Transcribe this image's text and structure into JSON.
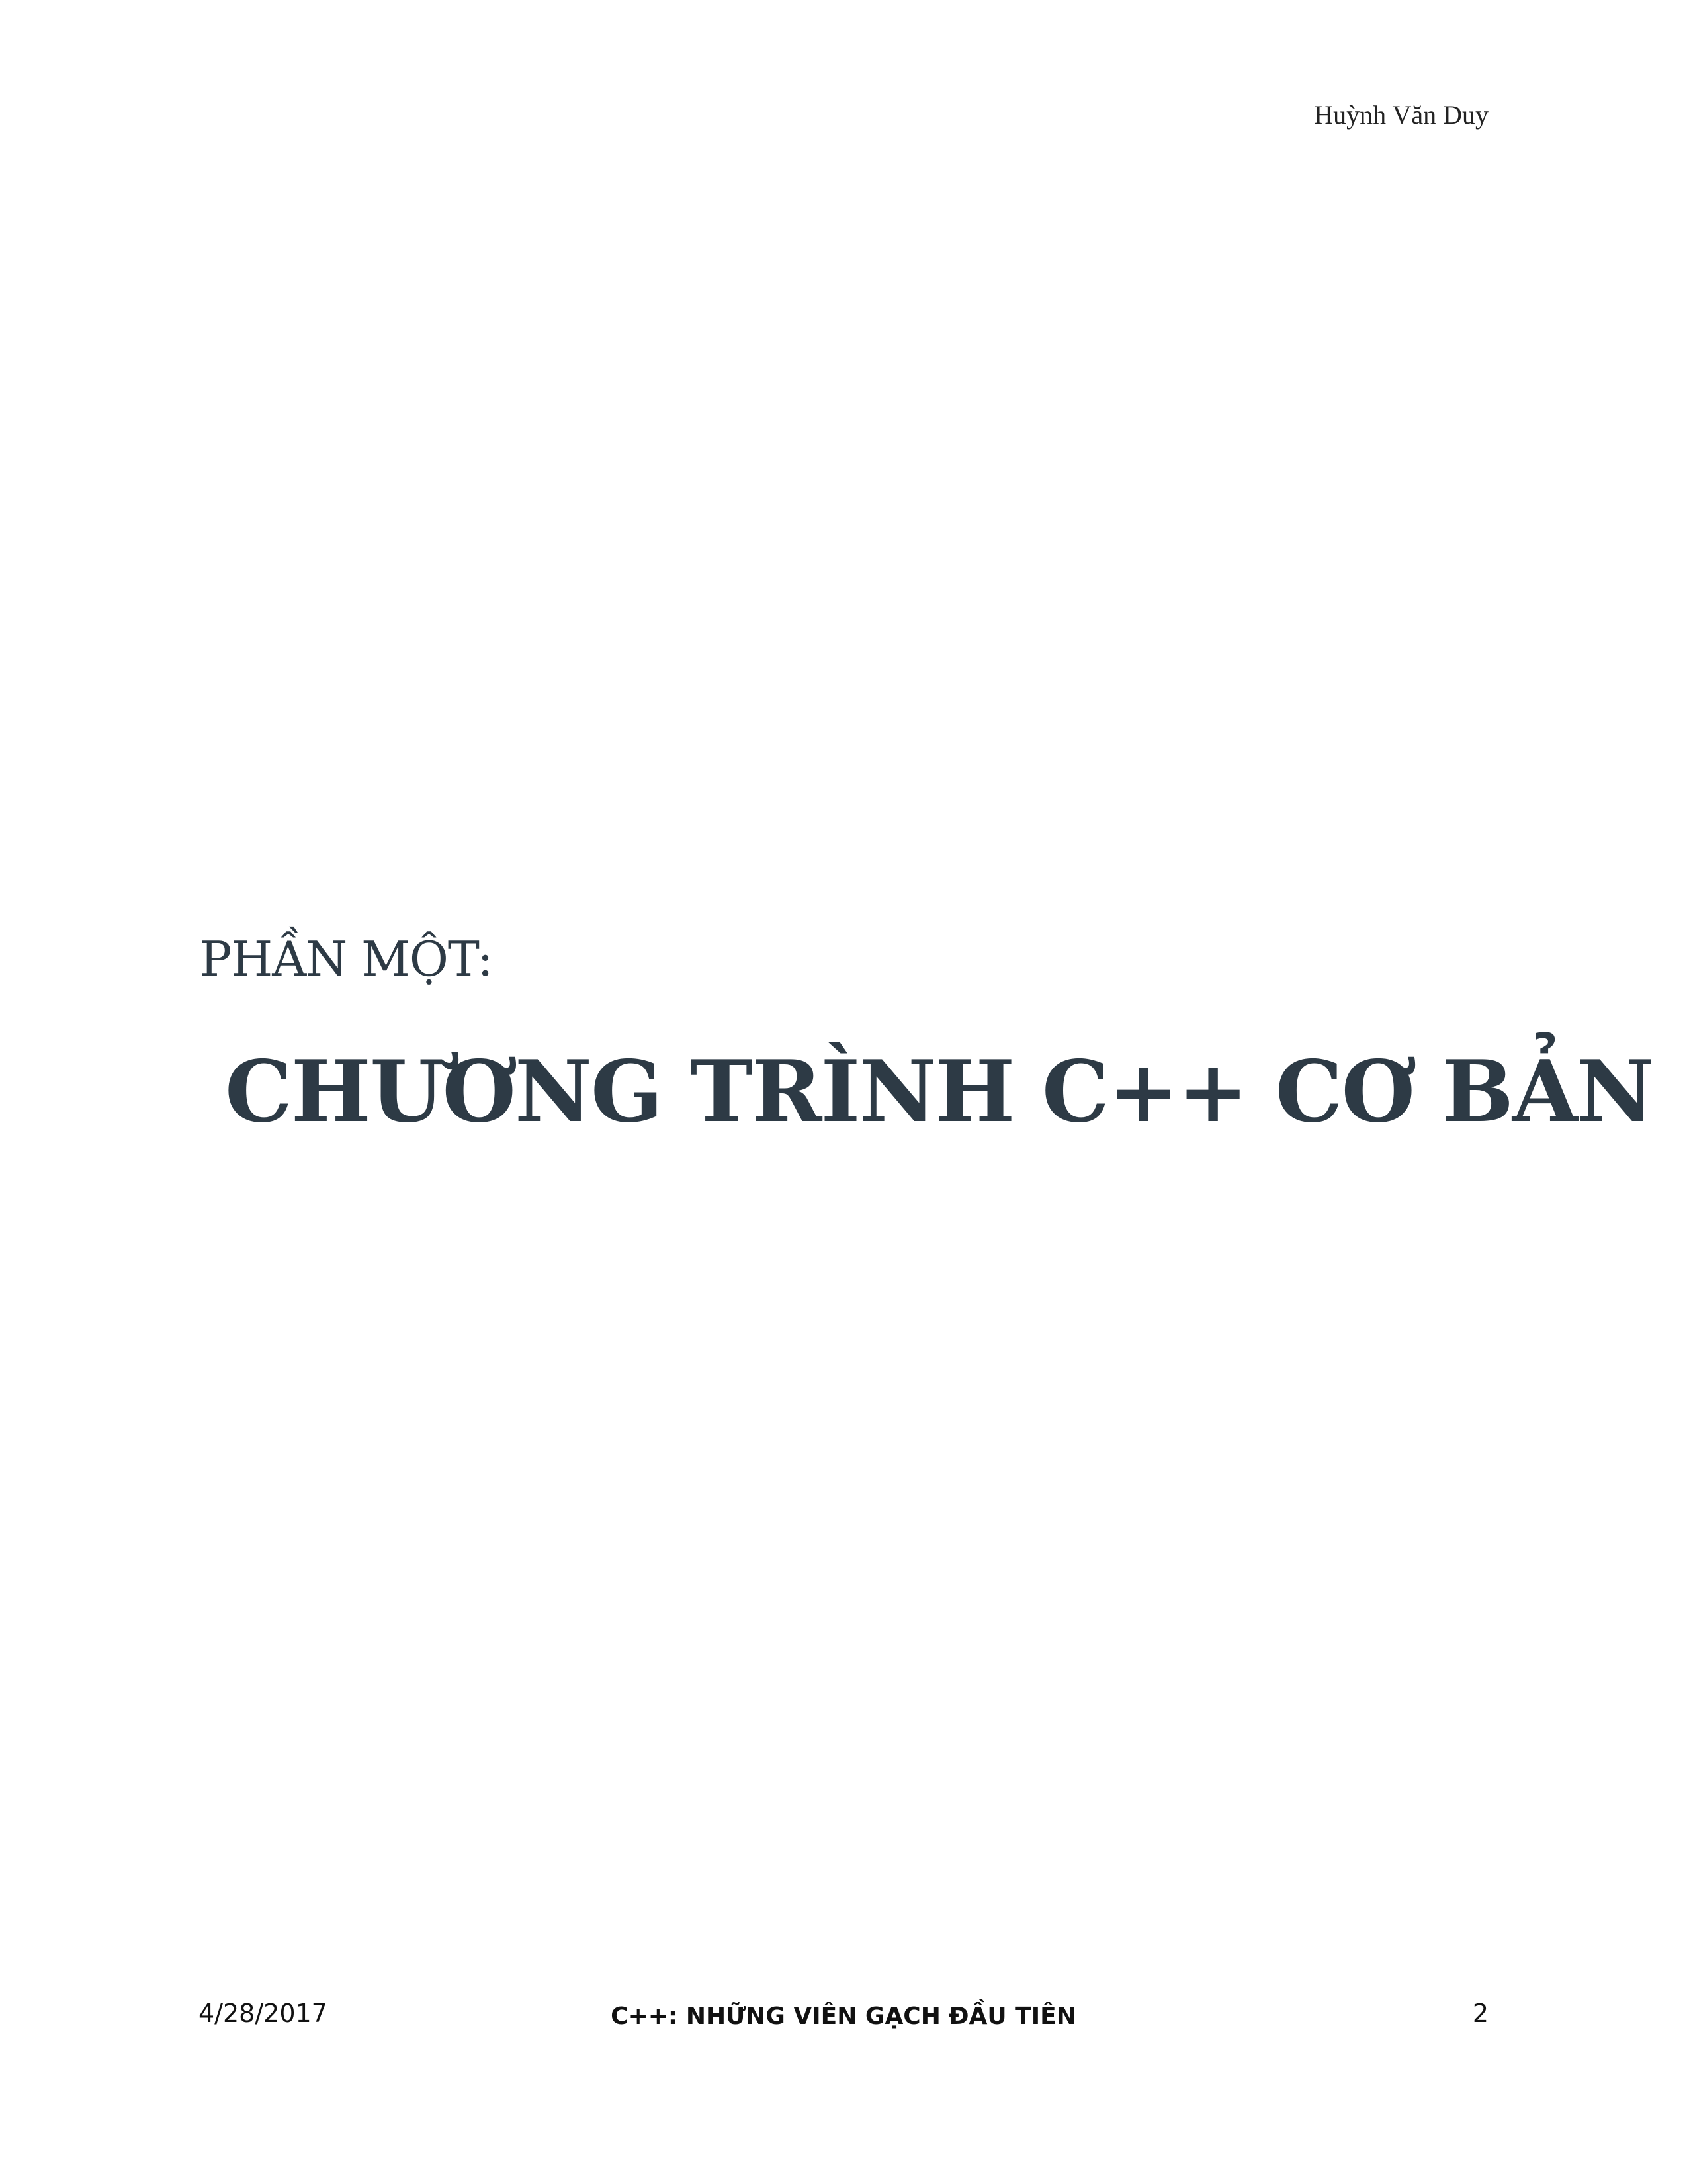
{
  "header": {
    "author": "Huỳnh Văn Duy"
  },
  "main": {
    "part_label": "PHẦN MỘT:",
    "chapter_title": "CHƯƠNG TRÌNH C++ CƠ BẢN"
  },
  "footer": {
    "date": "4/28/2017",
    "book_title": "C++: NHỮNG VIÊN GẠCH ĐẦU TIÊN",
    "page_number": "2"
  },
  "colors": {
    "heading": "#2d3a45",
    "text": "#111111",
    "background": "#ffffff"
  }
}
